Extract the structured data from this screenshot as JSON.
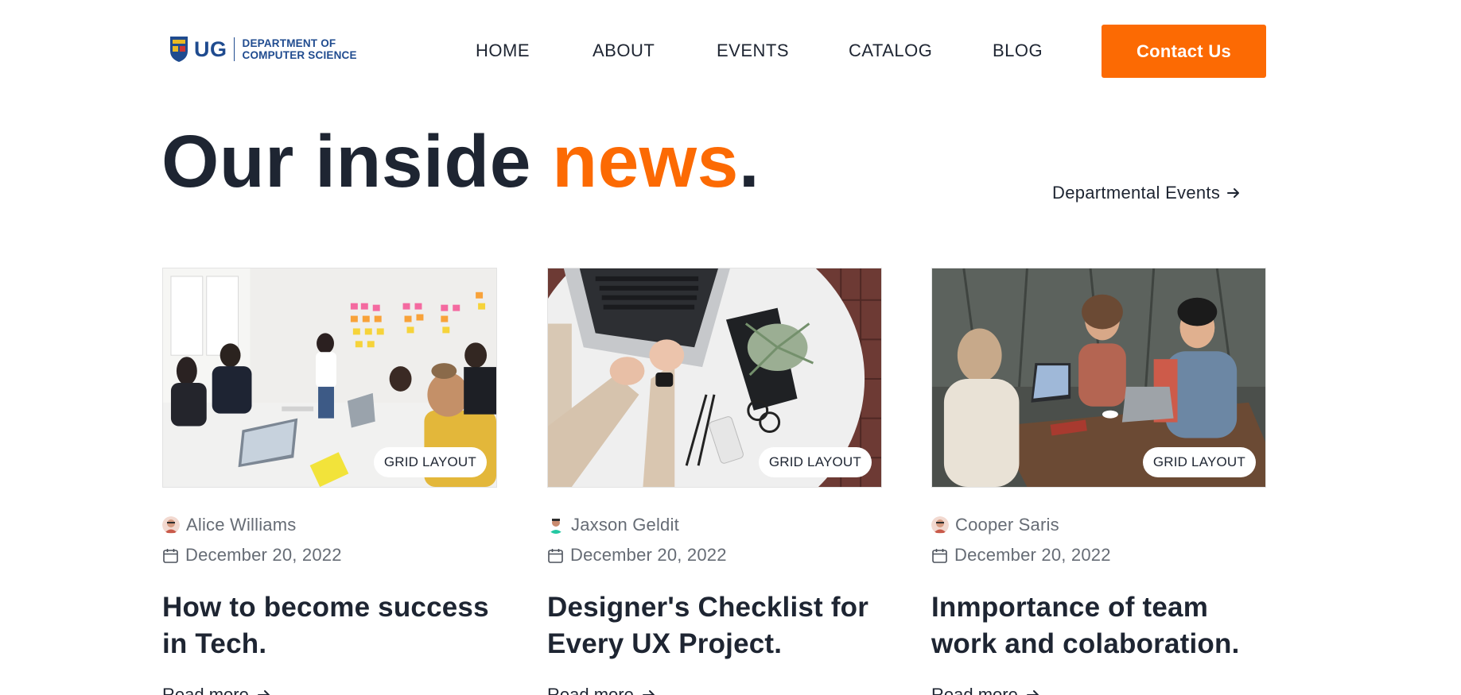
{
  "logo": {
    "short": "UG",
    "line1": "DEPARTMENT OF",
    "line2": "COMPUTER SCIENCE",
    "icon": "university-crest-icon"
  },
  "nav": {
    "items": [
      "HOME",
      "ABOUT",
      "EVENTS",
      "CATALOG",
      "BLOG"
    ],
    "contact_label": "Contact Us"
  },
  "hero": {
    "title_part1": "Our inside ",
    "title_accent": "news",
    "title_end": ".",
    "events_link": "Departmental Events"
  },
  "colors": {
    "accent": "#fc6a03",
    "heading": "#1e2532",
    "meta": "#666c75"
  },
  "posts": [
    {
      "tag": "GRID LAYOUT",
      "author": "Alice Williams",
      "date": "December 20, 2022",
      "title": "How to become success in Tech.",
      "read_more": "Read more"
    },
    {
      "tag": "GRID LAYOUT",
      "author": "Jaxson Geldit",
      "date": "December 20, 2022",
      "title": "Designer's Checklist for Every UX Project.",
      "read_more": "Read more"
    },
    {
      "tag": "GRID LAYOUT",
      "author": "Cooper Saris",
      "date": "December 20, 2022",
      "title": "Inmportance of team work and colaboration.",
      "read_more": "Read more"
    }
  ]
}
